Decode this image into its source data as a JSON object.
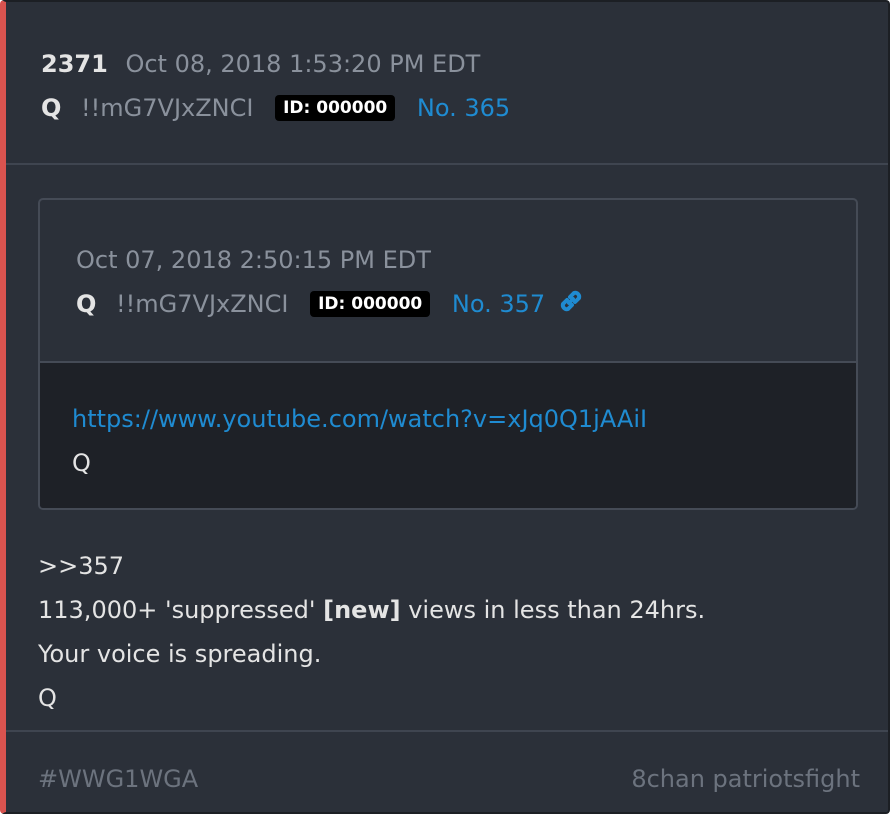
{
  "post": {
    "number": "2371",
    "timestamp": "Oct 08, 2018 1:53:20 PM EDT",
    "author": "Q",
    "tripcode": "!!mG7VJxZNCI",
    "id_badge": "ID: 000000",
    "post_no": "No. 365"
  },
  "quoted_post": {
    "timestamp": "Oct 07, 2018 2:50:15 PM EDT",
    "author": "Q",
    "tripcode": "!!mG7VJxZNCI",
    "id_badge": "ID: 000000",
    "post_no": "No. 357",
    "link_text": "https://www.youtube.com/watch?v=xJq0Q1jAAiI",
    "signature": "Q"
  },
  "body": {
    "reply_ref": ">>357",
    "line2_before": "113,000+ 'suppressed' ",
    "line2_bold": "[new]",
    "line2_after": " views in less than 24hrs.",
    "line3": "Your voice is spreading.",
    "line4": "Q"
  },
  "footer": {
    "hashtag": "#WWG1WGA",
    "source": "8chan patriotsfight"
  },
  "colors": {
    "accent_border": "#d9534f",
    "link": "#1f8bd1",
    "background": "#2b3039"
  },
  "icons": {
    "quoted_link": "chain-link-icon"
  }
}
